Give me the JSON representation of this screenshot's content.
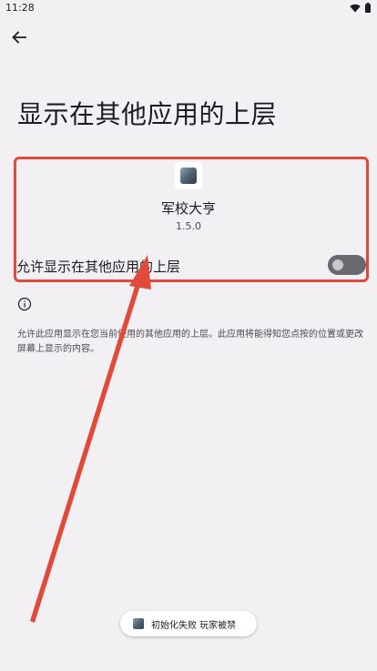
{
  "status_bar": {
    "time": "11:28",
    "icons": [
      "wifi-icon",
      "battery-icon"
    ]
  },
  "header": {
    "back_icon": "arrow-left-icon",
    "title": "显示在其他应用的上层"
  },
  "app": {
    "name": "军校大亨",
    "version": "1.5.0",
    "icon": "app-icon"
  },
  "permission": {
    "label": "允许显示在其他应用的上层",
    "enabled": false
  },
  "info": {
    "icon": "info-icon",
    "description": "允许此应用显示在您当前使用的其他应用的上层。此应用将能得知您点按的位置或更改屏幕上显示的内容。"
  },
  "toast": {
    "text": "初始化失败 玩家被禁"
  },
  "colors": {
    "background": "#f3f0f4",
    "annotation": "#e04a3a",
    "toggle_track": "#6a6870"
  }
}
